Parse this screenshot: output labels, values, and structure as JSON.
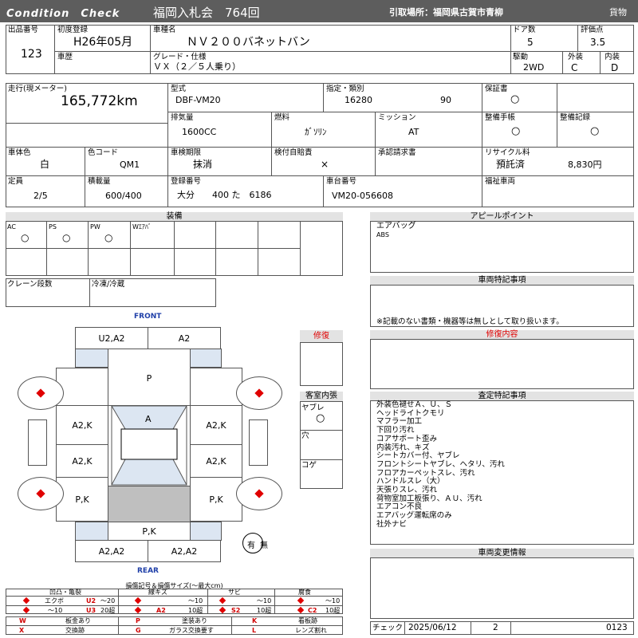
{
  "header": {
    "brand": "Condition　Check",
    "auction": "福岡入札会　764回",
    "pickup": "引取場所：福岡県古賀市青柳",
    "category": "貨物"
  },
  "info": {
    "lot_no_label": "出品番号",
    "lot_no": "123",
    "first_reg_label": "初度登録",
    "first_reg": "H26年05月",
    "model_name_label": "車種名",
    "model_name": "ＮＶ２００バネットバン",
    "doors_label": "ドア数",
    "doors": "5",
    "score_label": "評価点",
    "score": "3.5",
    "history_label": "車歴",
    "grade_label": "グレード・仕様",
    "grade": "ＶＸ（２／５人乗り）",
    "drive_label": "駆動",
    "drive": "2WD",
    "exterior_label": "外装",
    "exterior": "C",
    "interior_label": "内装",
    "interior": "D",
    "mileage_label": "走行(現メーター)",
    "mileage": "165,772km",
    "type_label": "型式",
    "type": "DBF-VM20",
    "designation_label": "指定・類別",
    "designation": "16280",
    "category_no": "90",
    "warranty_label": "保証書",
    "warranty": "○",
    "displacement_label": "排気量",
    "displacement": "1600CC",
    "fuel_label": "燃料",
    "fuel": "ｶﾞｿﾘﾝ",
    "mission_label": "ミッション",
    "mission": "AT",
    "manual_label": "整備手帳",
    "manual": "○",
    "maint_label": "整備記録",
    "maint": "○",
    "body_color_label": "車体色",
    "body_color": "白",
    "color_code_label": "色コード",
    "color_code": "QM1",
    "inspection_label": "車検期限",
    "inspection": "抹消",
    "insurance_label": "検付自賠責",
    "insurance": "×",
    "approval_label": "承認請求書",
    "recycle_label": "リサイクル料",
    "recycle_status": "預託済",
    "recycle_fee": "8,830円",
    "capacity_label": "定員",
    "capacity": "2/5",
    "load_label": "積載量",
    "load": "600/400",
    "reg_no_label": "登録番号",
    "reg_no": "大分　　400 た　6186",
    "chassis_label": "車台番号",
    "chassis": "VM20-056608",
    "welfare_label": "福祉車両"
  },
  "equipment": {
    "title": "装備",
    "items": [
      {
        "label": "AC",
        "mark": "○"
      },
      {
        "label": "PS",
        "mark": "○"
      },
      {
        "label": "PW",
        "mark": "○"
      },
      {
        "label": "Wｴｱﾊﾞ",
        "mark": ""
      }
    ],
    "crane_label": "クレーン段数",
    "cooler_label": "冷凍/冷蔵"
  },
  "appeal": {
    "title": "アピールポイント",
    "lines": [
      "エアバッグ",
      "ABS"
    ]
  },
  "special": {
    "title": "車両特記事項",
    "note": "※記載のない書類・機器等は無しとして取り扱います。"
  },
  "repair": {
    "tag": "修復",
    "title": "修復内容"
  },
  "interior_box": {
    "title": "客室内張",
    "rows": [
      {
        "label": "ヤブレ",
        "mark": "○"
      },
      {
        "label": "穴",
        "mark": ""
      },
      {
        "label": "コゲ",
        "mark": ""
      }
    ]
  },
  "inspect": {
    "title": "査定特記事項",
    "lines": [
      "外装色褪せＡ、Ｕ、Ｓ",
      "ヘッドライトクモリ",
      "マフラー加工",
      "下回り汚れ",
      "コアサポート歪み",
      "内装汚れ、キズ",
      "シートカバー付、ヤブレ",
      "フロントシートヤブレ、ヘタリ、汚れ",
      "フロアカーペットスレ、汚れ",
      "ハンドルスレ（大）",
      "天張りスレ、汚れ",
      "荷物室加工板張り、ＡＵ、汚れ",
      "エアコン不良",
      "エアバッグ運転席のみ",
      "社外ナビ"
    ]
  },
  "change": {
    "title": "車両変更情報"
  },
  "diagram": {
    "front": "FRONT",
    "rear": "REAR",
    "u_front": "U2,A2",
    "a2_front": "A2",
    "p_top": "P",
    "a2k_l1": "A2,K",
    "a_center": "A",
    "a2k_r1": "A2,K",
    "a2k_l2": "A2,K",
    "a2k_r2": "A2,K",
    "pk_l": "P,K",
    "pk_r": "P,K",
    "pk_bottom": "P,K",
    "a2_rl": "A2,A2",
    "a2_rr": "A2,A2",
    "yes": "有",
    "no": "無"
  },
  "legend": {
    "title": "損傷記号＆損傷サイズ(～最大cm)",
    "groups": [
      {
        "name": "凹凸・亀裂",
        "a": "エクボ",
        "a_size": "～20",
        "u1": "U2",
        "b": "～10",
        "u3": "U3",
        "u3_size": "20超"
      },
      {
        "name": "線キズ",
        "a": "～10",
        "c": "A2",
        "c_size": "10超"
      },
      {
        "name": "サビ",
        "a": "～10",
        "c": "S2",
        "c_size": "10超"
      },
      {
        "name": "腐食",
        "a": "～10",
        "c": "C2",
        "c_size": "10超"
      }
    ],
    "row1": [
      {
        "code": "W",
        "text": "板金あり"
      },
      {
        "code": "P",
        "text": "塗装あり"
      },
      {
        "code": "K",
        "text": "交換跡"
      }
    ],
    "row2": [
      {
        "code": "X",
        "text": "交換跡"
      },
      {
        "code": "G",
        "text": "ガラス交換要す"
      },
      {
        "code": "L",
        "text": "レンズ割れ"
      }
    ],
    "row1_extra": "看板跡"
  },
  "check": {
    "label": "チェック",
    "date": "2025/06/12",
    "num": "2",
    "code": "0123"
  }
}
